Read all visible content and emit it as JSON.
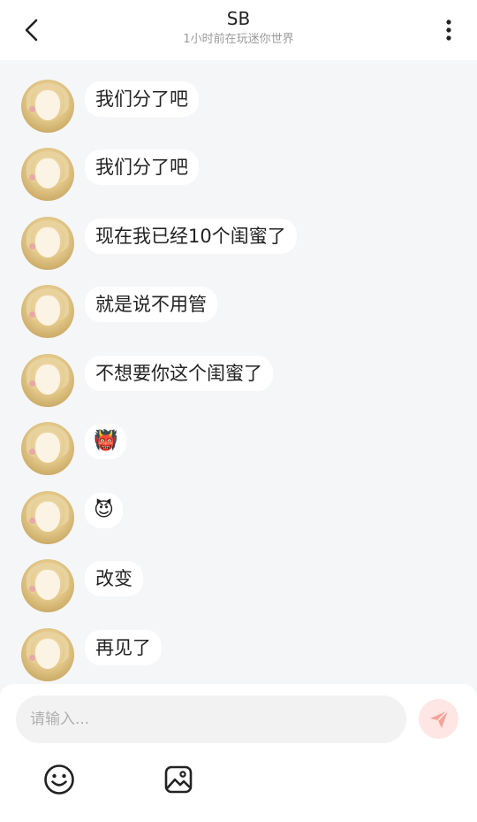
{
  "header": {
    "title": "SB",
    "subtitle": "1小时前在玩迷你世界"
  },
  "messages": [
    {
      "text": "我们分了吧"
    },
    {
      "text": "我们分了吧"
    },
    {
      "text": "现在我已经10个闺蜜了"
    },
    {
      "text": "就是说不用管"
    },
    {
      "text": "不想要你这个闺蜜了"
    },
    {
      "text": "👹"
    },
    {
      "text": "😈"
    },
    {
      "text": "改变"
    },
    {
      "text": "再见了"
    }
  ],
  "composer": {
    "placeholder": "请输入..."
  },
  "colors": {
    "background": "#f5f6f8",
    "send_button": "#fde6e3",
    "send_icon": "#f4a39a"
  },
  "icons": {
    "back": "chevron-left-icon",
    "more": "more-vertical-icon",
    "send": "send-icon",
    "emoji": "smiley-icon",
    "image": "image-icon"
  }
}
